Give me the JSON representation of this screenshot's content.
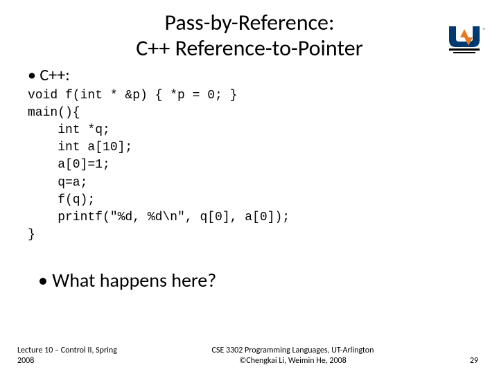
{
  "title": {
    "line1": "Pass-by-Reference:",
    "line2": "C++ Reference-to-Pointer"
  },
  "bullet1": "C++:",
  "code": "void f(int * &p) { *p = 0; }\nmain(){\n    int *q;\n    int a[10];\n    a[0]=1;\n    q=a;\n    f(q);\n    printf(\"%d, %d\\n\", q[0], a[0]);\n}",
  "question": "What happens here?",
  "footer": {
    "left": "Lecture 10 – Control II, Spring 2008",
    "centerLine1": "CSE 3302 Programming Languages, UT-Arlington",
    "centerLine2": "©Chengkai Li, Weimin He, 2008",
    "pageNumber": "29"
  }
}
